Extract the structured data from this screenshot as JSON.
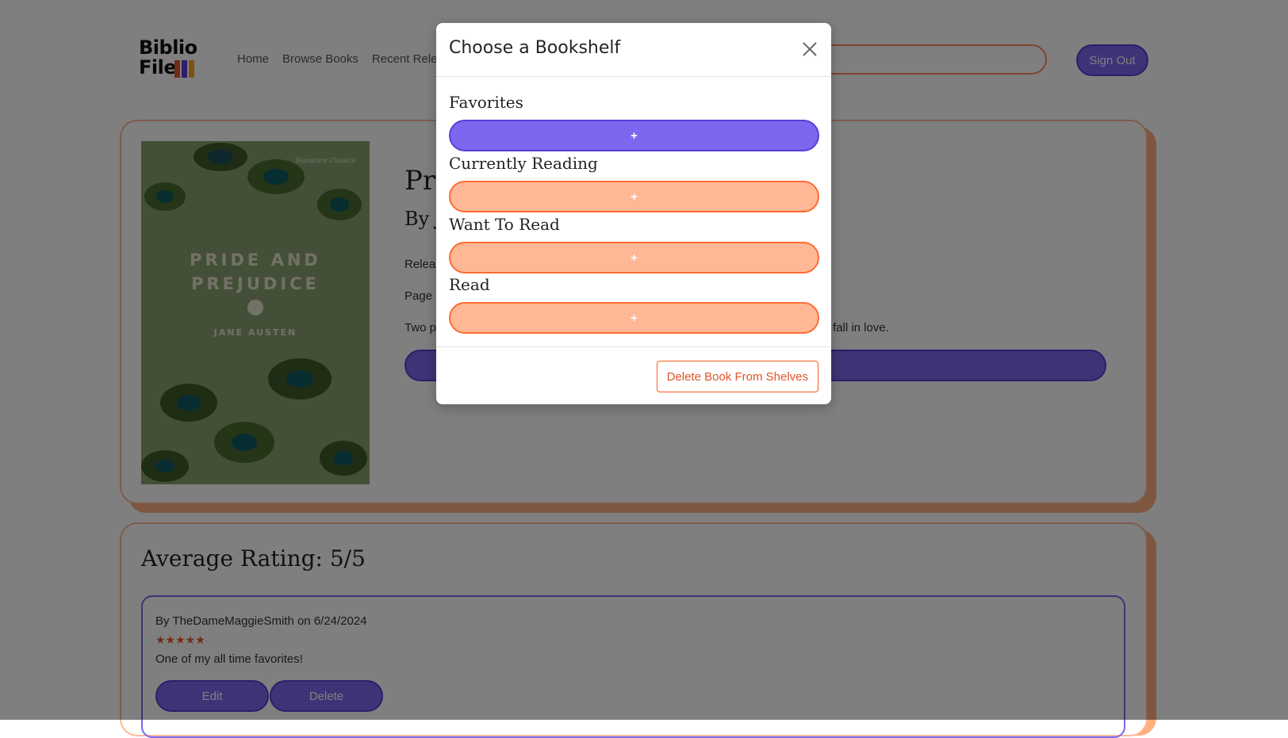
{
  "header": {
    "logo_line1": "Biblio",
    "logo_line2": "File",
    "nav": [
      "Home",
      "Browse Books",
      "Recent Rele"
    ],
    "signout_label": "Sign Out"
  },
  "book": {
    "cover_title": "PRIDE AND PREJUDICE",
    "cover_author": "JANE AUSTEN",
    "cover_series": "Signature Classics",
    "title_visible": "Pri",
    "author_visible": "By J",
    "release_visible": "Releas",
    "page_visible": "Page",
    "desc_start_visible": "Two p",
    "desc_end_visible": "fall in love."
  },
  "ratings": {
    "average": "Average Rating: 5/5",
    "review": {
      "by": "By TheDameMaggieSmith on 6/24/2024",
      "stars": "★★★★★",
      "text": "One of my all time favorites!",
      "edit_label": "Edit",
      "delete_label": "Delete"
    }
  },
  "modal": {
    "title": "Choose a Bookshelf",
    "shelves": [
      {
        "label": "Favorites",
        "button": "+",
        "state": "active"
      },
      {
        "label": "Currently Reading",
        "button": "+",
        "state": "inactive"
      },
      {
        "label": "Want To Read",
        "button": "+",
        "state": "inactive"
      },
      {
        "label": "Read",
        "button": "+",
        "state": "inactive"
      }
    ],
    "delete_label": "Delete Book From Shelves"
  },
  "colors": {
    "accent_purple": "#7b68ee",
    "accent_orange": "#ffb896",
    "orange_border": "#ff6a33"
  }
}
